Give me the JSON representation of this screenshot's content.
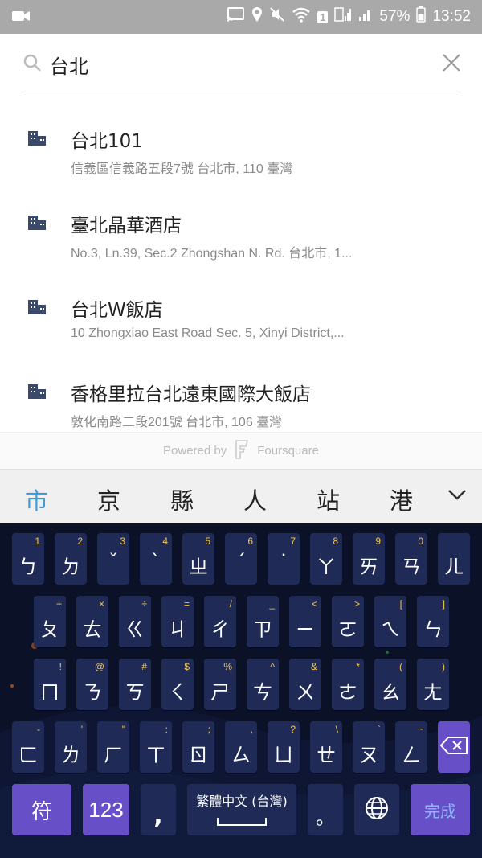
{
  "status_bar": {
    "battery": "57%",
    "time": "13:52",
    "sim_badge": "1"
  },
  "search": {
    "query": "台北"
  },
  "results": [
    {
      "name": "台北101",
      "address": "信義區信義路五段7號 台北市, 110 臺灣"
    },
    {
      "name": "臺北晶華酒店",
      "address": "No.3, Ln.39, Sec.2 Zhongshan N. Rd. 台北市, 1..."
    },
    {
      "name": "台北W飯店",
      "address": "10 Zhongxiao East Road Sec. 5, Xinyi District,..."
    },
    {
      "name": "香格里拉台北遠東國際大飯店",
      "address": "敦化南路二段201號 台北市, 106 臺灣"
    }
  ],
  "powered": {
    "prefix": "Powered by",
    "brand": "Foursquare"
  },
  "candidates": [
    "市",
    "京",
    "縣",
    "人",
    "站",
    "港"
  ],
  "keyboard": {
    "row1": [
      {
        "main": "ㄅ",
        "hint": "1"
      },
      {
        "main": "ㄉ",
        "hint": "2"
      },
      {
        "main": "ˇ",
        "hint": "3"
      },
      {
        "main": "ˋ",
        "hint": "4"
      },
      {
        "main": "ㄓ",
        "hint": "5"
      },
      {
        "main": "ˊ",
        "hint": "6"
      },
      {
        "main": "˙",
        "hint": "7"
      },
      {
        "main": "ㄚ",
        "hint": "8"
      },
      {
        "main": "ㄞ",
        "hint": "9"
      },
      {
        "main": "ㄢ",
        "hint": "0"
      },
      {
        "main": "ㄦ",
        "hint": ""
      }
    ],
    "row2": [
      {
        "main": "ㄆ",
        "hint": "+"
      },
      {
        "main": "ㄊ",
        "hint": "×"
      },
      {
        "main": "ㄍ",
        "hint": "÷"
      },
      {
        "main": "ㄐ",
        "hint": "="
      },
      {
        "main": "ㄔ",
        "hint": "/"
      },
      {
        "main": "ㄗ",
        "hint": "_"
      },
      {
        "main": "ㄧ",
        "hint": "<"
      },
      {
        "main": "ㄛ",
        "hint": ">"
      },
      {
        "main": "ㄟ",
        "hint": "["
      },
      {
        "main": "ㄣ",
        "hint": "]"
      }
    ],
    "row3": [
      {
        "main": "ㄇ",
        "hint": "!"
      },
      {
        "main": "ㄋ",
        "hint": "@"
      },
      {
        "main": "ㄎ",
        "hint": "#"
      },
      {
        "main": "ㄑ",
        "hint": "$"
      },
      {
        "main": "ㄕ",
        "hint": "%"
      },
      {
        "main": "ㄘ",
        "hint": "^"
      },
      {
        "main": "ㄨ",
        "hint": "&"
      },
      {
        "main": "ㄜ",
        "hint": "*"
      },
      {
        "main": "ㄠ",
        "hint": "("
      },
      {
        "main": "ㄤ",
        "hint": ")"
      }
    ],
    "row4": [
      {
        "main": "ㄈ",
        "hint": "-"
      },
      {
        "main": "ㄌ",
        "hint": "'"
      },
      {
        "main": "ㄏ",
        "hint": "\""
      },
      {
        "main": "ㄒ",
        "hint": ":"
      },
      {
        "main": "ㄖ",
        "hint": ";"
      },
      {
        "main": "ㄙ",
        "hint": ","
      },
      {
        "main": "ㄩ",
        "hint": "?"
      },
      {
        "main": "ㄝ",
        "hint": "\\"
      },
      {
        "main": "ㄡ",
        "hint": "`"
      },
      {
        "main": "ㄥ",
        "hint": "~"
      }
    ],
    "symbols_label": "符",
    "numbers_label": "123",
    "comma_label": ",",
    "space_label": "繁體中文 (台灣)",
    "period_label": "。",
    "done_label": "完成"
  }
}
